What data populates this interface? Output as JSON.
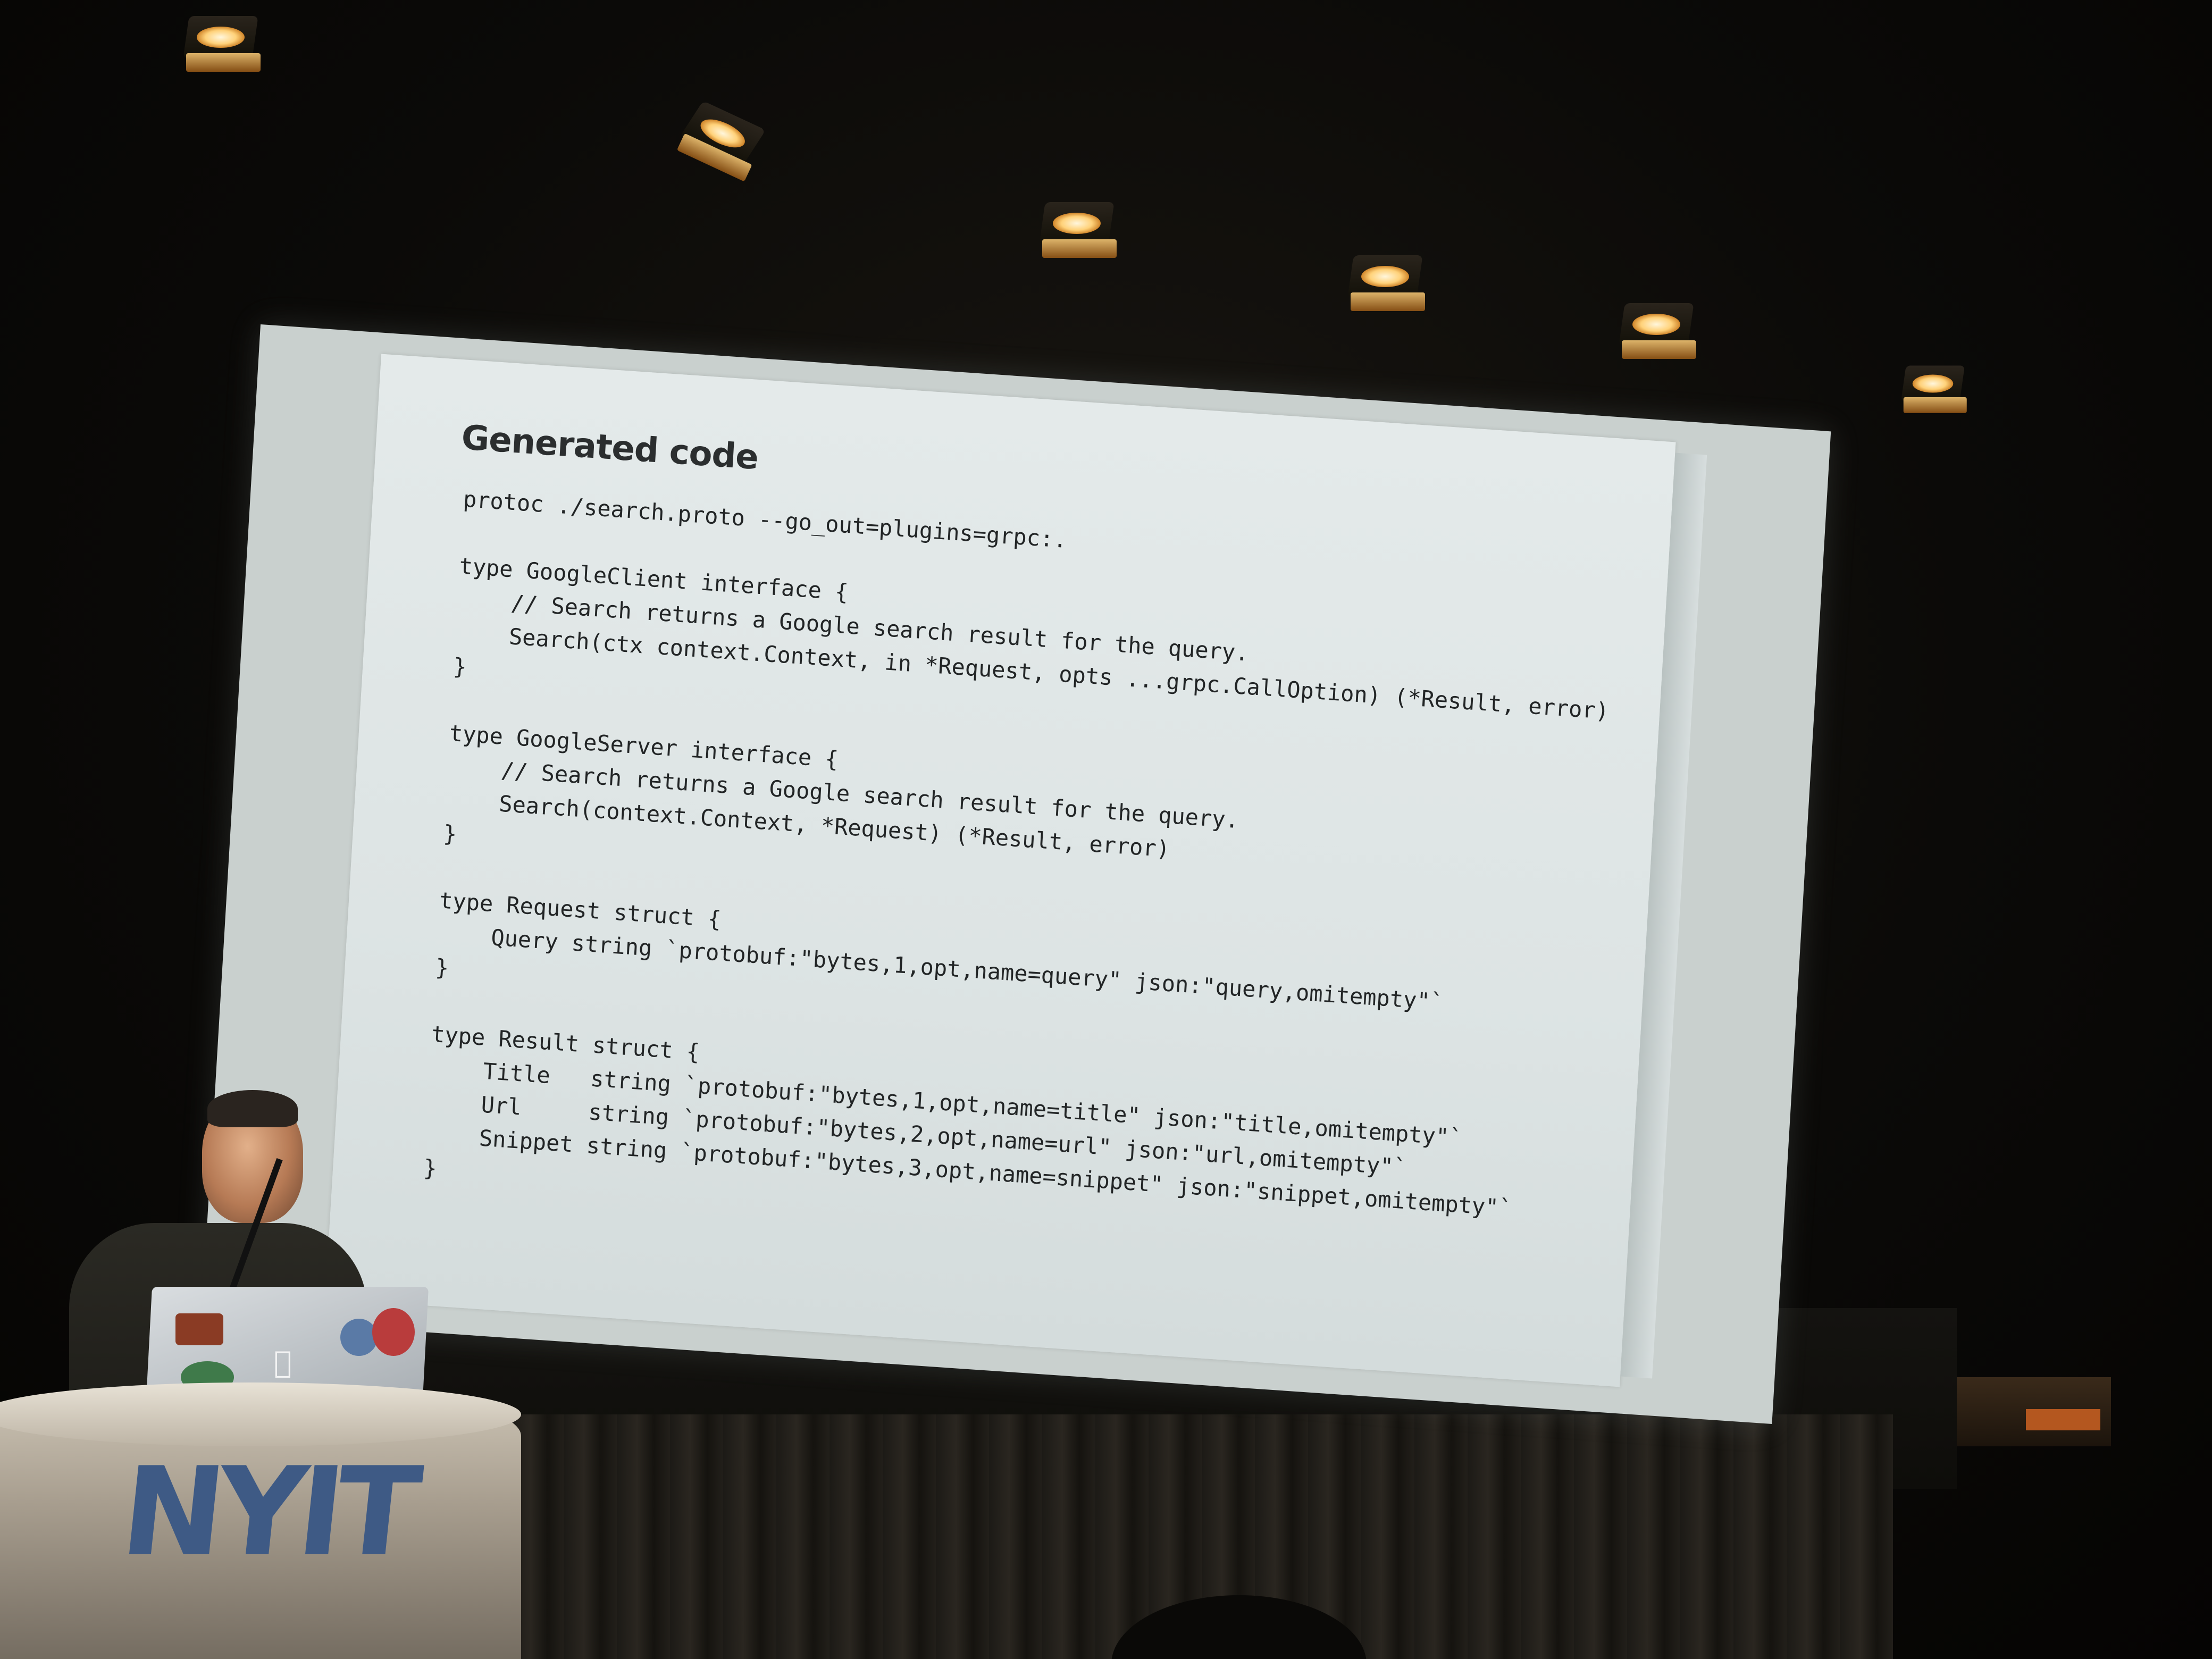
{
  "slide": {
    "title": "Generated code",
    "code_lines": [
      "protoc ./search.proto --go_out=plugins=grpc:.",
      "",
      "type GoogleClient interface {",
      "    // Search returns a Google search result for the query.",
      "    Search(ctx context.Context, in *Request, opts ...grpc.CallOption) (*Result, error)",
      "}",
      "",
      "type GoogleServer interface {",
      "    // Search returns a Google search result for the query.",
      "    Search(context.Context, *Request) (*Result, error)",
      "}",
      "",
      "type Request struct {",
      "    Query string `protobuf:\"bytes,1,opt,name=query\" json:\"query,omitempty\"`",
      "}",
      "",
      "type Result struct {",
      "    Title   string `protobuf:\"bytes,1,opt,name=title\" json:\"title,omitempty\"`",
      "    Url     string `protobuf:\"bytes,2,opt,name=url\" json:\"url,omitempty\"`",
      "    Snippet string `protobuf:\"bytes,3,opt,name=snippet\" json:\"snippet,omitempty\"`",
      "}"
    ]
  },
  "podium": {
    "logo_text": "NYIT",
    "logo_color": "#3e5a85"
  },
  "colors": {
    "slide_background": "#e2e8e8",
    "slide_text": "#222526",
    "room_dark": "#0b0a08",
    "light_warm": "#ffd27a"
  },
  "icons": {
    "laptop_logo": "apple-logo-icon"
  }
}
